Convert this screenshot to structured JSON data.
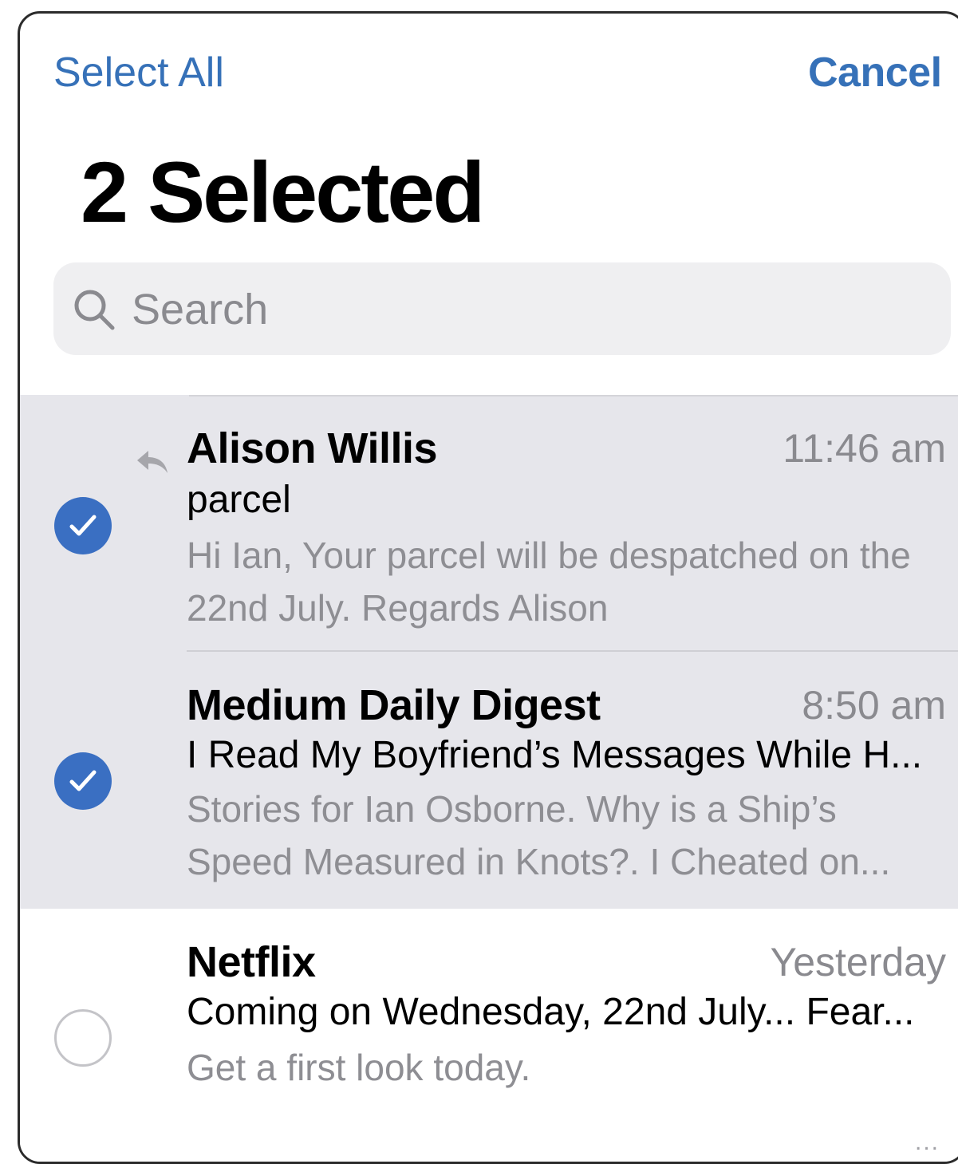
{
  "header": {
    "select_all_label": "Select All",
    "cancel_label": "Cancel",
    "title": "2 Selected"
  },
  "search": {
    "placeholder": "Search"
  },
  "messages": [
    {
      "sender": "Alison Willis",
      "time": "11:46 am",
      "subject": "parcel",
      "preview": "Hi Ian, Your parcel will be despatched on the 22nd July. Regards Alison",
      "selected": true,
      "replied": true
    },
    {
      "sender": "Medium Daily Digest",
      "time": "8:50 am",
      "subject": "I Read My Boyfriend’s Messages While H...",
      "preview": "Stories for Ian Osborne. Why is a Ship’s Speed Measured in Knots?. I Cheated on...",
      "selected": true,
      "replied": false
    },
    {
      "sender": "Netflix",
      "time": "Yesterday",
      "subject": "Coming on Wednesday, 22nd July... Fear...",
      "preview": "Get a first look today.",
      "selected": false,
      "replied": false
    }
  ],
  "footer": {
    "more_label": "..."
  },
  "colors": {
    "accent": "#3671b8",
    "checkbox_selected": "#3a6fc2",
    "selected_row_bg": "#e6e6eb",
    "secondary_text": "#8e8e93"
  }
}
